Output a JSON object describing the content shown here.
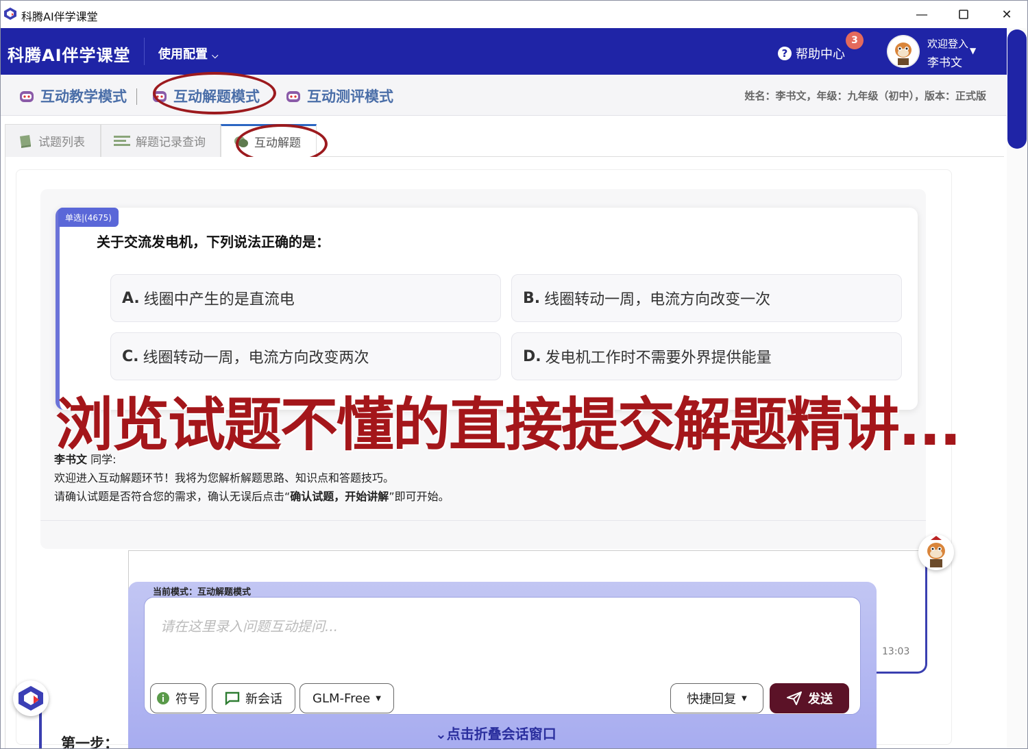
{
  "window": {
    "title": "科腾AI伴学课堂",
    "min": "—",
    "max": "☐",
    "close": "✕"
  },
  "navbar": {
    "brand": "科腾AI伴学课堂",
    "config": "使用配置",
    "help": "帮助中心",
    "help_badge": "3",
    "welcome": "欢迎登入",
    "user": "李书文"
  },
  "modes": [
    {
      "label": "互动教学模式"
    },
    {
      "label": "互动解题模式"
    },
    {
      "label": "互动测评模式"
    }
  ],
  "student_info": "姓名：李书文，年级：九年级（初中），版本：正式版",
  "tabs": [
    {
      "label": "试题列表"
    },
    {
      "label": "解题记录查询"
    },
    {
      "label": "互动解题"
    }
  ],
  "question": {
    "type": "单选|(4675)",
    "text": "关于交流发电机，下列说法正确的是：",
    "options": [
      {
        "letter": "A.",
        "text": "线圈中产生的是直流电"
      },
      {
        "letter": "B.",
        "text": "线圈转动一周，电流方向改变一次"
      },
      {
        "letter": "C.",
        "text": "线圈转动一周，电流方向改变两次"
      },
      {
        "letter": "D.",
        "text": "发电机工作时不需要外界提供能量"
      }
    ]
  },
  "overlay_text": "浏览试题不懂的直接提交解题精讲...",
  "message": {
    "name": "李书文",
    "suffix": " 同学:",
    "line1": "欢迎进入互动解题环节！我将为您解析解题思路、知识点和答题技巧。",
    "line2_pre": "请确认试题是否符合您的需求，确认无误后点击“",
    "line2_bold": "确认试题，开始讲解",
    "line2_post": "”即可开始。"
  },
  "chat": {
    "time": "13:03",
    "current_mode": "当前模式：互动解题模式",
    "placeholder": "请在这里录入问题互动提问...",
    "buttons": {
      "symbol": "符号",
      "new_chat": "新会话",
      "model": "GLM-Free",
      "quick_reply": "快捷回复",
      "send": "发送"
    },
    "collapse": "点击折叠会话窗口"
  },
  "step": "第一步：",
  "colors": {
    "navbar": "#1f24a6",
    "accent": "#2b2f9e",
    "overlay": "#a4161a",
    "send": "#5b1227"
  }
}
